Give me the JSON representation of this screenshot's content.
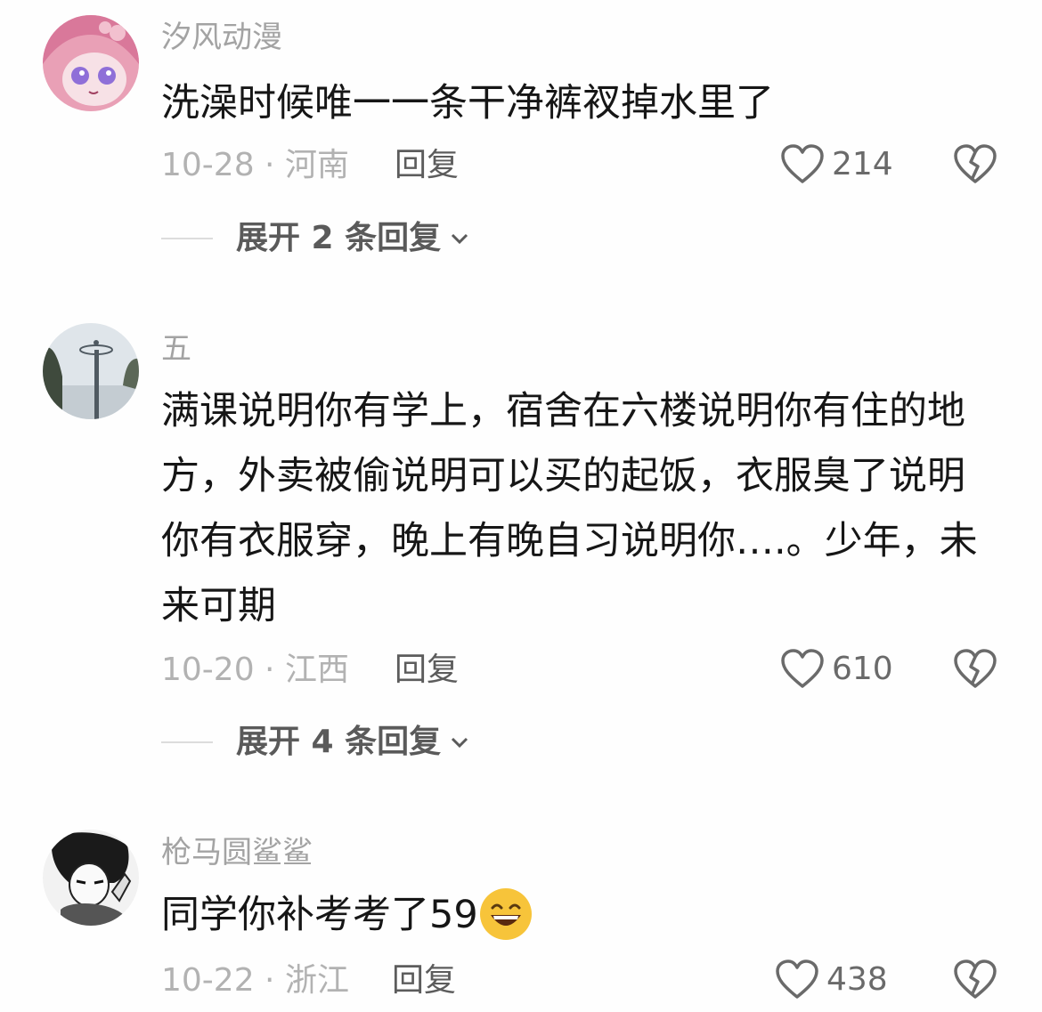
{
  "comments": [
    {
      "username": "汐风动漫",
      "text": "洗澡时候唯一一条干净裤衩掉水里了",
      "date_location": "10-28 · 河南",
      "reply_label": "回复",
      "likes": "214",
      "expand_label": "展开 2 条回复"
    },
    {
      "username": "五",
      "text": "满课说明你有学上，宿舍在六楼说明你有住的地方，外卖被偷说明可以买的起饭，衣服臭了说明你有衣服穿，晚上有晚自习说明你….。少年，未来可期",
      "date_location": "10-20 · 江西",
      "reply_label": "回复",
      "likes": "610",
      "expand_label": "展开 4 条回复"
    },
    {
      "username": "枪马圆鲨鲨",
      "text": "同学你补考考了59",
      "date_location": "10-22 · 浙江",
      "reply_label": "回复",
      "likes": "438"
    }
  ],
  "icons": {
    "like": "heart-icon",
    "dislike": "broken-heart-icon",
    "expand": "chevron-down-icon",
    "emoji": "grinning-face-emoji"
  },
  "colors": {
    "username": "#a3a3a3",
    "text": "#161616",
    "meta": "#b2b2b2",
    "reply": "#5c5c5c"
  }
}
